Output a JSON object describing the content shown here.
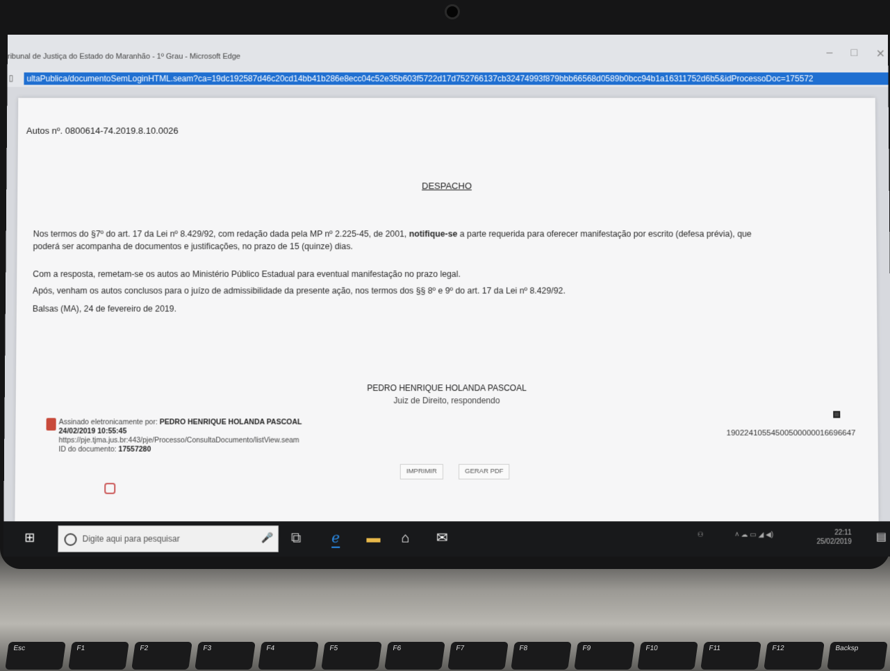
{
  "browser": {
    "title": "ribunal de Justiça do Estado do Maranhão - 1º Grau - Microsoft Edge",
    "url": "ultaPublica/documentoSemLoginHTML.seam?ca=19dc192587d46c20cd14bb41b286e8ecc04c52e35b603f5722d17d752766137cb32474993f879bbb66568d0589b0bcc94b1a16311752d6b5&idProcessoDoc=175572",
    "minimize": "–",
    "maximize": "□",
    "close": "✕"
  },
  "document": {
    "case_number": "Autos nº. 0800614-74.2019.8.10.0026",
    "heading": "DESPACHO",
    "paragraph1_a": "Nos termos do §7º do art. 17 da Lei nº 8.429/92, com redação dada pela MP nº 2.225-45, de 2001, ",
    "paragraph1_bold": "notifique-se",
    "paragraph1_b": " a parte requerida para oferecer manifestação por escrito (defesa prévia), que",
    "paragraph1_c": "poderá ser acompanha de documentos e justificações, no prazo de 15 (quinze) dias.",
    "paragraph2": "Com a resposta, remetam-se os autos ao Ministério Público Estadual para eventual manifestação no prazo legal.",
    "paragraph3": "Após, venham os autos conclusos para o juízo de admissibilidade da presente ação, nos termos dos §§ 8º e 9º do art. 17 da Lei nº 8.429/92.",
    "date_place": "Balsas (MA), 24 de fevereiro de 2019.",
    "signer": "PEDRO HENRIQUE HOLANDA PASCOAL",
    "signer_role": "Juiz de Direito, respondendo",
    "signature_label": "Assinado eletronicamente por: ",
    "signature_name": "PEDRO HENRIQUE HOLANDA PASCOAL",
    "signature_datetime": "24/02/2019 10:55:45",
    "signature_url": "https://pje.tjma.jus.br:443/pje/Processo/ConsultaDocumento/listView.seam",
    "doc_id_label": "ID do documento: ",
    "doc_id": "17557280",
    "barcode_number": "19022410554500500000016696647",
    "print_button": "IMPRIMIR",
    "pdf_button": "GERAR PDF"
  },
  "taskbar": {
    "search_placeholder": "Digite aqui para pesquisar",
    "time": "22:11",
    "date": "25/02/2019"
  },
  "keyboard": [
    "Esc",
    "F1",
    "F2",
    "F3",
    "F4",
    "F5",
    "F6",
    "F7",
    "F8",
    "F9",
    "F10",
    "F11",
    "F12",
    "Backsp"
  ]
}
